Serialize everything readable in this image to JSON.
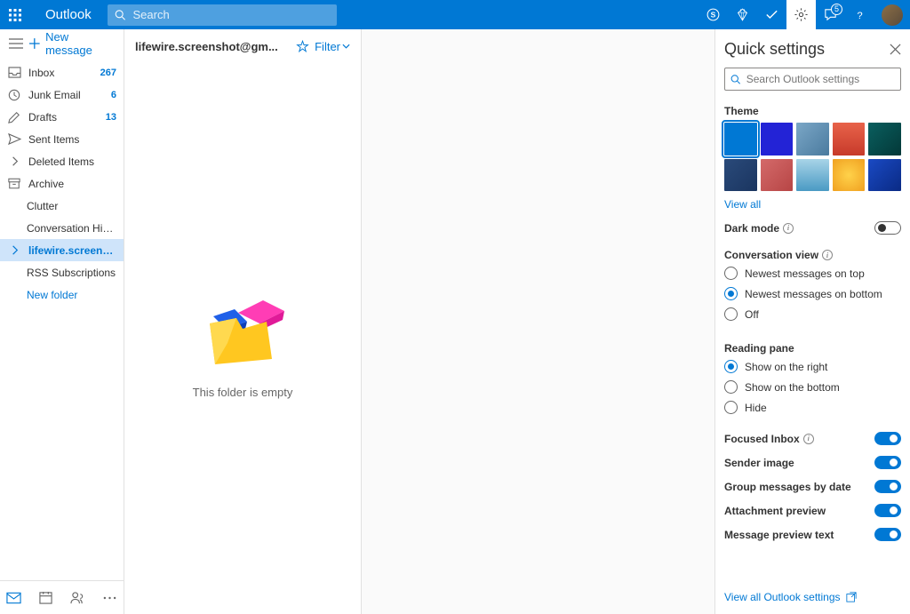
{
  "brand": "Outlook",
  "search": {
    "placeholder": "Search"
  },
  "notifications_badge": "5",
  "newMessage": "New message",
  "folders": [
    {
      "key": "inbox",
      "name": "Inbox",
      "count": "267",
      "icon": "inbox",
      "indent": false
    },
    {
      "key": "junk",
      "name": "Junk Email",
      "count": "6",
      "icon": "clock",
      "indent": false
    },
    {
      "key": "drafts",
      "name": "Drafts",
      "count": "13",
      "icon": "pencil",
      "indent": false
    },
    {
      "key": "sent",
      "name": "Sent Items",
      "count": "",
      "icon": "send",
      "indent": false
    },
    {
      "key": "deleted",
      "name": "Deleted Items",
      "count": "",
      "icon": "chevron",
      "indent": false
    },
    {
      "key": "archive",
      "name": "Archive",
      "count": "",
      "icon": "archive",
      "indent": false
    },
    {
      "key": "clutter",
      "name": "Clutter",
      "count": "",
      "icon": "",
      "indent": true
    },
    {
      "key": "convhist",
      "name": "Conversation Hist...",
      "count": "",
      "icon": "",
      "indent": true
    },
    {
      "key": "lifewire",
      "name": "lifewire.screensho...",
      "count": "",
      "icon": "chevron",
      "indent": false,
      "selected": true
    },
    {
      "key": "rss",
      "name": "RSS Subscriptions",
      "count": "",
      "icon": "",
      "indent": true
    }
  ],
  "newFolder": "New folder",
  "msglist": {
    "title": "lifewire.screenshot@gm...",
    "filter": "Filter",
    "empty": "This folder is empty"
  },
  "settings": {
    "title": "Quick settings",
    "searchPlaceholder": "Search Outlook settings",
    "themeLabel": "Theme",
    "viewAll": "View all",
    "darkMode": "Dark mode",
    "conversationView": "Conversation view",
    "convOptions": [
      "Newest messages on top",
      "Newest messages on bottom",
      "Off"
    ],
    "convSelected": 1,
    "readingPane": "Reading pane",
    "paneOptions": [
      "Show on the right",
      "Show on the bottom",
      "Hide"
    ],
    "paneSelected": 0,
    "toggles": [
      {
        "label": "Focused Inbox",
        "on": true,
        "info": true
      },
      {
        "label": "Sender image",
        "on": true,
        "info": false
      },
      {
        "label": "Group messages by date",
        "on": true,
        "info": false
      },
      {
        "label": "Attachment preview",
        "on": true,
        "info": false
      },
      {
        "label": "Message preview text",
        "on": true,
        "info": false
      }
    ],
    "viewAllSettings": "View all Outlook settings"
  },
  "themes": [
    "#0078d4",
    "#2323d6",
    "linear-gradient(135deg,#7ba7c7,#4a7a9e)",
    "linear-gradient(180deg,#e8634a,#c73a2a)",
    "linear-gradient(135deg,#0a5f5f,#033838)",
    "linear-gradient(135deg,#2a4a7a,#1a3560)",
    "linear-gradient(135deg,#d46a6a,#b74545)",
    "linear-gradient(180deg,#a8d4e8,#4a9ac4)",
    "radial-gradient(circle,#ffd24a,#f0a020)",
    "linear-gradient(135deg,#1a4ac4,#0a2a84)"
  ]
}
